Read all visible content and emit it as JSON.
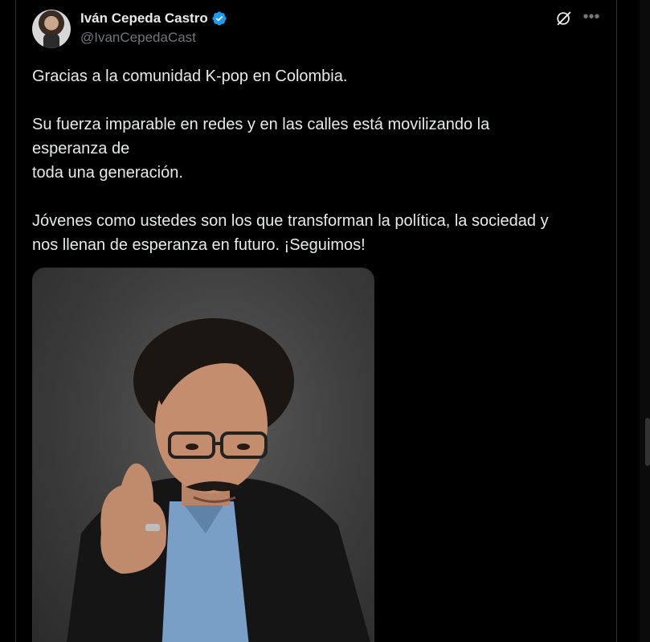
{
  "author": {
    "display_name": "Iván Cepeda Castro",
    "handle": "@IvanCepedaCast",
    "verified": true,
    "avatar_icon": "avatar-photo"
  },
  "actions": {
    "grok_icon": "grok-icon",
    "more_icon": "more-icon"
  },
  "tweet": {
    "lines": [
      "Gracias a la comunidad K-pop en Colombia.",
      "",
      "Su fuerza imparable en redes y en las calles está movilizando la",
      "esperanza de",
      "toda una generación.",
      "",
      "Jóvenes como ustedes son los que transforman la política, la sociedad y",
      "nos llenan de esperanza en futuro. ¡Seguimos!"
    ]
  },
  "media": {
    "type": "photo"
  },
  "colors": {
    "background": "#000000",
    "text": "#e7e9ea",
    "muted": "#71767b",
    "verified": "#1d9bf0",
    "border": "#2f3336"
  }
}
